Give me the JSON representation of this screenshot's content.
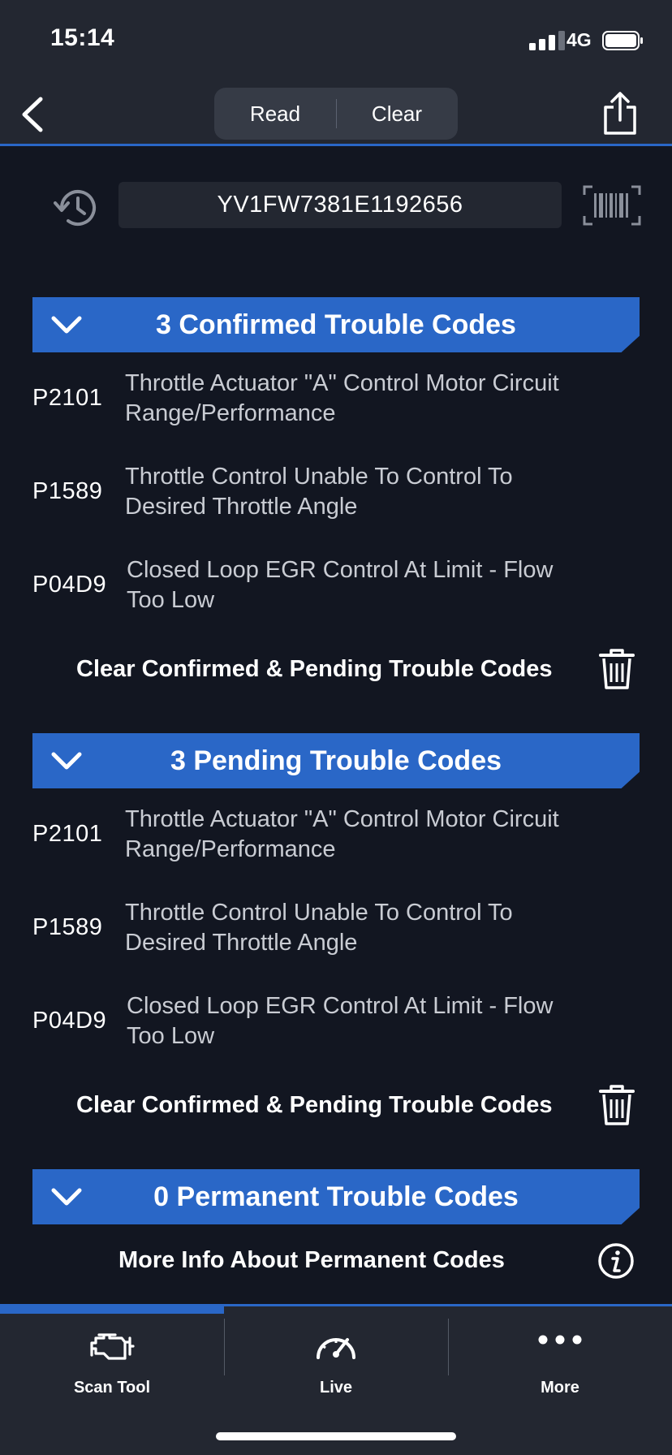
{
  "status_bar": {
    "time": "15:14",
    "network": "4G"
  },
  "header": {
    "segments": {
      "read": "Read",
      "clear": "Clear"
    }
  },
  "vin": {
    "value": "YV1FW7381E1192656"
  },
  "sections": [
    {
      "title": "3 Confirmed Trouble Codes",
      "codes": [
        {
          "code": "P2101",
          "line1": "Throttle Actuator \"A\" Control Motor Circuit",
          "line2": "Range/Performance"
        },
        {
          "code": "P1589",
          "line1": "Throttle Control Unable To Control To",
          "line2": "Desired Throttle Angle"
        },
        {
          "code": "P04D9",
          "line1": "Closed Loop EGR Control At Limit - Flow",
          "line2": "Too Low"
        }
      ],
      "action": "Clear Confirmed & Pending Trouble Codes"
    },
    {
      "title": "3 Pending Trouble Codes",
      "codes": [
        {
          "code": "P2101",
          "line1": "Throttle Actuator \"A\" Control Motor Circuit",
          "line2": "Range/Performance"
        },
        {
          "code": "P1589",
          "line1": "Throttle Control Unable To Control To",
          "line2": "Desired Throttle Angle"
        },
        {
          "code": "P04D9",
          "line1": "Closed Loop EGR Control At Limit - Flow",
          "line2": "Too Low"
        }
      ],
      "action": "Clear Confirmed & Pending Trouble Codes"
    },
    {
      "title": "0 Permanent Trouble Codes",
      "action": "More Info About Permanent Codes"
    }
  ],
  "tabs": [
    {
      "label": "Scan Tool",
      "icon": "engine-icon"
    },
    {
      "label": "Live",
      "icon": "gauge-icon"
    },
    {
      "label": "More",
      "icon": "more-dots-icon"
    }
  ],
  "colors": {
    "accent": "#2a67c7",
    "background": "#121621",
    "bar": "#232731"
  }
}
